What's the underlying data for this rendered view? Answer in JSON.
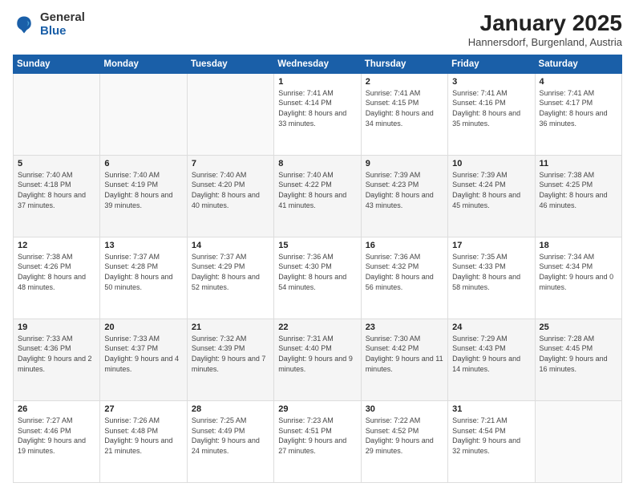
{
  "logo": {
    "general": "General",
    "blue": "Blue"
  },
  "header": {
    "month": "January 2025",
    "location": "Hannersdorf, Burgenland, Austria"
  },
  "weekdays": [
    "Sunday",
    "Monday",
    "Tuesday",
    "Wednesday",
    "Thursday",
    "Friday",
    "Saturday"
  ],
  "weeks": [
    [
      {
        "day": "",
        "info": ""
      },
      {
        "day": "",
        "info": ""
      },
      {
        "day": "",
        "info": ""
      },
      {
        "day": "1",
        "info": "Sunrise: 7:41 AM\nSunset: 4:14 PM\nDaylight: 8 hours and 33 minutes."
      },
      {
        "day": "2",
        "info": "Sunrise: 7:41 AM\nSunset: 4:15 PM\nDaylight: 8 hours and 34 minutes."
      },
      {
        "day": "3",
        "info": "Sunrise: 7:41 AM\nSunset: 4:16 PM\nDaylight: 8 hours and 35 minutes."
      },
      {
        "day": "4",
        "info": "Sunrise: 7:41 AM\nSunset: 4:17 PM\nDaylight: 8 hours and 36 minutes."
      }
    ],
    [
      {
        "day": "5",
        "info": "Sunrise: 7:40 AM\nSunset: 4:18 PM\nDaylight: 8 hours and 37 minutes."
      },
      {
        "day": "6",
        "info": "Sunrise: 7:40 AM\nSunset: 4:19 PM\nDaylight: 8 hours and 39 minutes."
      },
      {
        "day": "7",
        "info": "Sunrise: 7:40 AM\nSunset: 4:20 PM\nDaylight: 8 hours and 40 minutes."
      },
      {
        "day": "8",
        "info": "Sunrise: 7:40 AM\nSunset: 4:22 PM\nDaylight: 8 hours and 41 minutes."
      },
      {
        "day": "9",
        "info": "Sunrise: 7:39 AM\nSunset: 4:23 PM\nDaylight: 8 hours and 43 minutes."
      },
      {
        "day": "10",
        "info": "Sunrise: 7:39 AM\nSunset: 4:24 PM\nDaylight: 8 hours and 45 minutes."
      },
      {
        "day": "11",
        "info": "Sunrise: 7:38 AM\nSunset: 4:25 PM\nDaylight: 8 hours and 46 minutes."
      }
    ],
    [
      {
        "day": "12",
        "info": "Sunrise: 7:38 AM\nSunset: 4:26 PM\nDaylight: 8 hours and 48 minutes."
      },
      {
        "day": "13",
        "info": "Sunrise: 7:37 AM\nSunset: 4:28 PM\nDaylight: 8 hours and 50 minutes."
      },
      {
        "day": "14",
        "info": "Sunrise: 7:37 AM\nSunset: 4:29 PM\nDaylight: 8 hours and 52 minutes."
      },
      {
        "day": "15",
        "info": "Sunrise: 7:36 AM\nSunset: 4:30 PM\nDaylight: 8 hours and 54 minutes."
      },
      {
        "day": "16",
        "info": "Sunrise: 7:36 AM\nSunset: 4:32 PM\nDaylight: 8 hours and 56 minutes."
      },
      {
        "day": "17",
        "info": "Sunrise: 7:35 AM\nSunset: 4:33 PM\nDaylight: 8 hours and 58 minutes."
      },
      {
        "day": "18",
        "info": "Sunrise: 7:34 AM\nSunset: 4:34 PM\nDaylight: 9 hours and 0 minutes."
      }
    ],
    [
      {
        "day": "19",
        "info": "Sunrise: 7:33 AM\nSunset: 4:36 PM\nDaylight: 9 hours and 2 minutes."
      },
      {
        "day": "20",
        "info": "Sunrise: 7:33 AM\nSunset: 4:37 PM\nDaylight: 9 hours and 4 minutes."
      },
      {
        "day": "21",
        "info": "Sunrise: 7:32 AM\nSunset: 4:39 PM\nDaylight: 9 hours and 7 minutes."
      },
      {
        "day": "22",
        "info": "Sunrise: 7:31 AM\nSunset: 4:40 PM\nDaylight: 9 hours and 9 minutes."
      },
      {
        "day": "23",
        "info": "Sunrise: 7:30 AM\nSunset: 4:42 PM\nDaylight: 9 hours and 11 minutes."
      },
      {
        "day": "24",
        "info": "Sunrise: 7:29 AM\nSunset: 4:43 PM\nDaylight: 9 hours and 14 minutes."
      },
      {
        "day": "25",
        "info": "Sunrise: 7:28 AM\nSunset: 4:45 PM\nDaylight: 9 hours and 16 minutes."
      }
    ],
    [
      {
        "day": "26",
        "info": "Sunrise: 7:27 AM\nSunset: 4:46 PM\nDaylight: 9 hours and 19 minutes."
      },
      {
        "day": "27",
        "info": "Sunrise: 7:26 AM\nSunset: 4:48 PM\nDaylight: 9 hours and 21 minutes."
      },
      {
        "day": "28",
        "info": "Sunrise: 7:25 AM\nSunset: 4:49 PM\nDaylight: 9 hours and 24 minutes."
      },
      {
        "day": "29",
        "info": "Sunrise: 7:23 AM\nSunset: 4:51 PM\nDaylight: 9 hours and 27 minutes."
      },
      {
        "day": "30",
        "info": "Sunrise: 7:22 AM\nSunset: 4:52 PM\nDaylight: 9 hours and 29 minutes."
      },
      {
        "day": "31",
        "info": "Sunrise: 7:21 AM\nSunset: 4:54 PM\nDaylight: 9 hours and 32 minutes."
      },
      {
        "day": "",
        "info": ""
      }
    ]
  ]
}
